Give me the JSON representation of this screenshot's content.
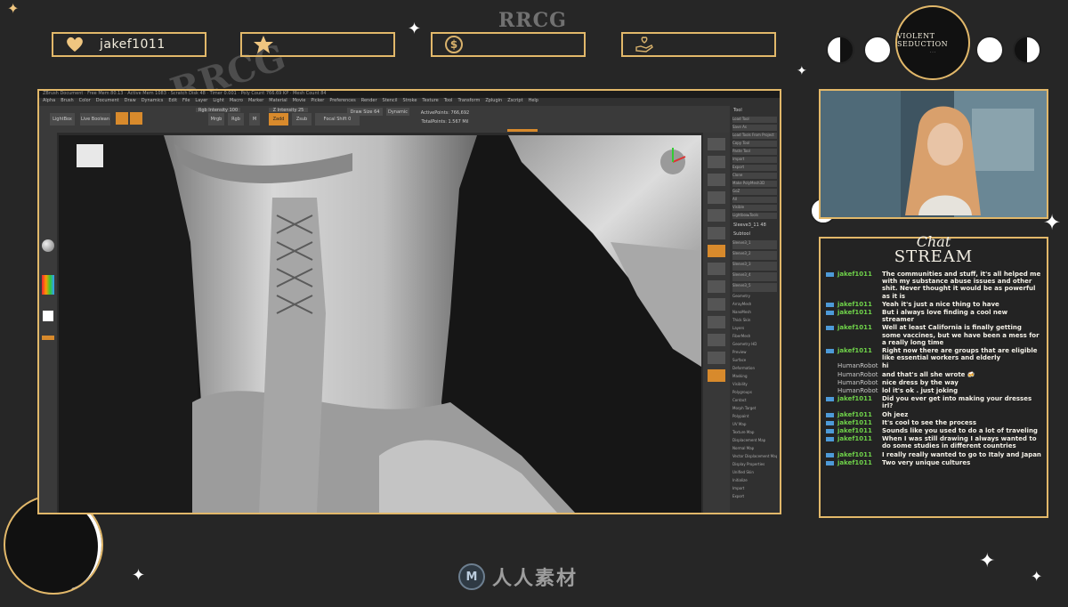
{
  "overlay": {
    "follower_name": "jakef1011",
    "star_value": "",
    "donation_value": "",
    "support_value": "",
    "brand_watermark": "RRCG",
    "bottom_logo_text": "人人素材",
    "emblem_title": "VIOLENT SEDUCTION",
    "emblem_sub": "· · ·",
    "colors": {
      "gold": "#e2b86a",
      "background": "#262626",
      "username_green": "#6fd24a",
      "badge_blue": "#4d9ad8"
    }
  },
  "app": {
    "title": "ZBrush Document · Free Mem 80.13 · Active Mem 1083 · Scratch Disk 48 · Timer 0.001 · Poly Count 766.69 KP · Mesh Count 84",
    "menu": [
      "Alpha",
      "Brush",
      "Color",
      "Document",
      "Draw",
      "Dynamics",
      "Edit",
      "File",
      "Layer",
      "Light",
      "Macro",
      "Marker",
      "Material",
      "Movie",
      "Picker",
      "Preferences",
      "Render",
      "Stencil",
      "Stroke",
      "Texture",
      "Tool",
      "Transform",
      "Zplugin",
      "Zscript",
      "Help"
    ],
    "toolbar": {
      "lightbox": "LightBox",
      "live_boolean": "Live Boolean",
      "mrgb": "Mrgb",
      "rgb": "Rgb",
      "m": "M",
      "zadd": "Zadd",
      "zsub": "Zsub",
      "focal_shift": "Focal Shift 0",
      "draw_size": "Draw Size 64",
      "dynamic": "Dynamic",
      "rgb_intensity": "Rgb Intensity 100",
      "z_intensity": "Z Intensity 25",
      "active_points": "ActivePoints: 766,692",
      "total_points": "TotalPoints: 1.567 Mil"
    },
    "tool_panel": {
      "title": "Tool",
      "buttons": [
        "Load Tool",
        "Save As",
        "Load Tools From Project",
        "Copy Tool",
        "Paste Tool",
        "Import",
        "Export",
        "Clone",
        "Make PolyMesh3D",
        "GoZ",
        "All",
        "Visible",
        "Lightbox▸Tools"
      ],
      "current_tool": "Sleeve3_11 48",
      "subtool_label": "Subtool",
      "subtools": [
        "Sleeve3_1",
        "Sleeve3_2",
        "Sleeve3_3",
        "Sleeve3_4",
        "Sleeve3_5"
      ],
      "sections": [
        "Geometry",
        "ArrayMesh",
        "NanoMesh",
        "Thick Skin",
        "Layers",
        "FiberMesh",
        "Geometry HD",
        "Preview",
        "Surface",
        "Deformation",
        "Masking",
        "Visibility",
        "Polygroups",
        "Contact",
        "Morph Target",
        "Polypaint",
        "UV Map",
        "Texture Map",
        "Displacement Map",
        "Normal Map",
        "Vector Displacement Map",
        "Display Properties",
        "Unified Skin",
        "Initialize",
        "Import",
        "Export"
      ]
    }
  },
  "chat": {
    "heading_script": "Chat",
    "heading": "STREAM",
    "messages": [
      {
        "user": "jakef1011",
        "badge": true,
        "text": "The communities and stuff, it's all helped me with my substance abuse issues and other shit. Never thought it would be as powerful as it is"
      },
      {
        "user": "jakef1011",
        "badge": true,
        "text": "Yeah it's just a nice thing to have"
      },
      {
        "user": "jakef1011",
        "badge": true,
        "text": "But i always love finding a cool new streamer"
      },
      {
        "user": "jakef1011",
        "badge": true,
        "text": "Well at least California is finally getting some vaccines, but we have been a mess for a really long time"
      },
      {
        "user": "jakef1011",
        "badge": true,
        "text": "Right now there are groups that are eligible like essential workers and elderly"
      },
      {
        "user": "HumanRobot",
        "badge": false,
        "text": "hi"
      },
      {
        "user": "HumanRobot",
        "badge": false,
        "text": "and that's all she wrote 🍻"
      },
      {
        "user": "HumanRobot",
        "badge": false,
        "text": "nice dress by the way"
      },
      {
        "user": "HumanRobot",
        "badge": false,
        "text": "lol it's ok . just joking"
      },
      {
        "user": "jakef1011",
        "badge": true,
        "text": "Did you ever get into making your dresses irl?"
      },
      {
        "user": "jakef1011",
        "badge": true,
        "text": "Oh jeez"
      },
      {
        "user": "jakef1011",
        "badge": true,
        "text": "It's cool to see the process"
      },
      {
        "user": "jakef1011",
        "badge": true,
        "text": "Sounds like you used to do a lot of traveling"
      },
      {
        "user": "jakef1011",
        "badge": true,
        "text": "When I was still drawing I always wanted to do some studies in different countries"
      },
      {
        "user": "jakef1011",
        "badge": true,
        "text": "I really really wanted to go to Italy and Japan"
      },
      {
        "user": "jakef1011",
        "badge": true,
        "text": "Two very unique cultures"
      }
    ]
  },
  "icons": [
    "heart-icon",
    "star-icon",
    "dollar-icon",
    "hand-heart-icon",
    "moon-icon",
    "sparkle-icon"
  ]
}
